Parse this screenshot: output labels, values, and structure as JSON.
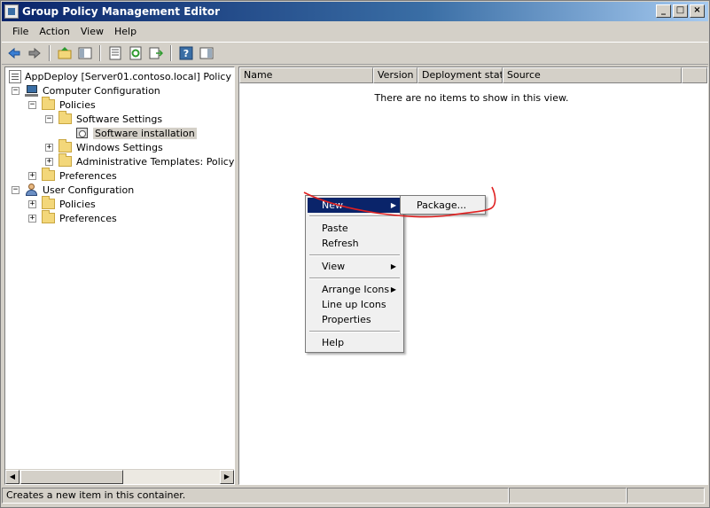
{
  "window": {
    "title": "Group Policy Management Editor"
  },
  "menubar": {
    "items": [
      "File",
      "Action",
      "View",
      "Help"
    ]
  },
  "tree": {
    "root": "AppDeploy [Server01.contoso.local] Policy",
    "computer_config": "Computer Configuration",
    "policies": "Policies",
    "software_settings": "Software Settings",
    "software_installation": "Software installation",
    "windows_settings": "Windows Settings",
    "admin_templates": "Administrative Templates: Policy defi",
    "preferences": "Preferences",
    "user_config": "User Configuration",
    "user_policies": "Policies",
    "user_preferences": "Preferences"
  },
  "list": {
    "columns": [
      "Name",
      "Version",
      "Deployment state",
      "Source"
    ],
    "empty_message": "There are no items to show in this view."
  },
  "context_menu": {
    "new": "New",
    "paste": "Paste",
    "refresh": "Refresh",
    "view": "View",
    "arrange_icons": "Arrange Icons",
    "line_up_icons": "Line up Icons",
    "properties": "Properties",
    "help": "Help"
  },
  "submenu": {
    "package": "Package..."
  },
  "statusbar": {
    "text": "Creates a new item in this container."
  },
  "colors": {
    "selection": "#0a246a",
    "annotation": "#e02020",
    "folder": "#f3d77a"
  }
}
